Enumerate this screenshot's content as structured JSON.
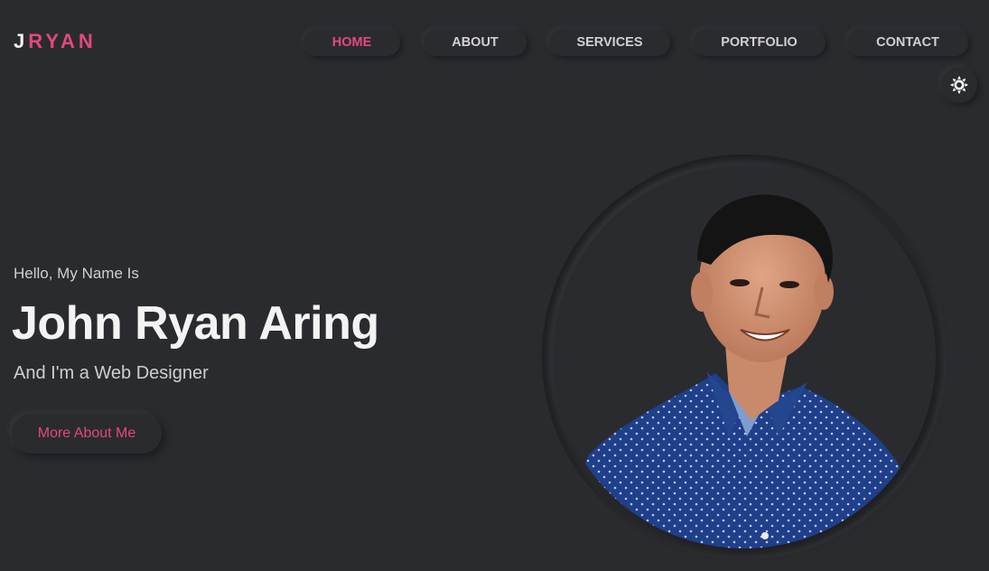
{
  "logo": {
    "part1": "J",
    "part2": "RYAN"
  },
  "nav": {
    "home": "HOME",
    "about": "ABOUT",
    "services": "SERVICES",
    "portfolio": "PORTFOLIO",
    "contact": "CONTACT",
    "active": "home"
  },
  "theme_toggle": {
    "icon": "sun-icon"
  },
  "hero": {
    "greeting": "Hello, My Name Is",
    "name": "John Ryan Aring",
    "role": "And I'm a Web Designer",
    "cta_label": "More About Me"
  },
  "profile": {
    "image": "profile-photo"
  },
  "colors": {
    "background": "#2a2b2f",
    "accent": "#e5477c",
    "text": "#f3f3f3",
    "muted_text": "#cfcfcf"
  }
}
